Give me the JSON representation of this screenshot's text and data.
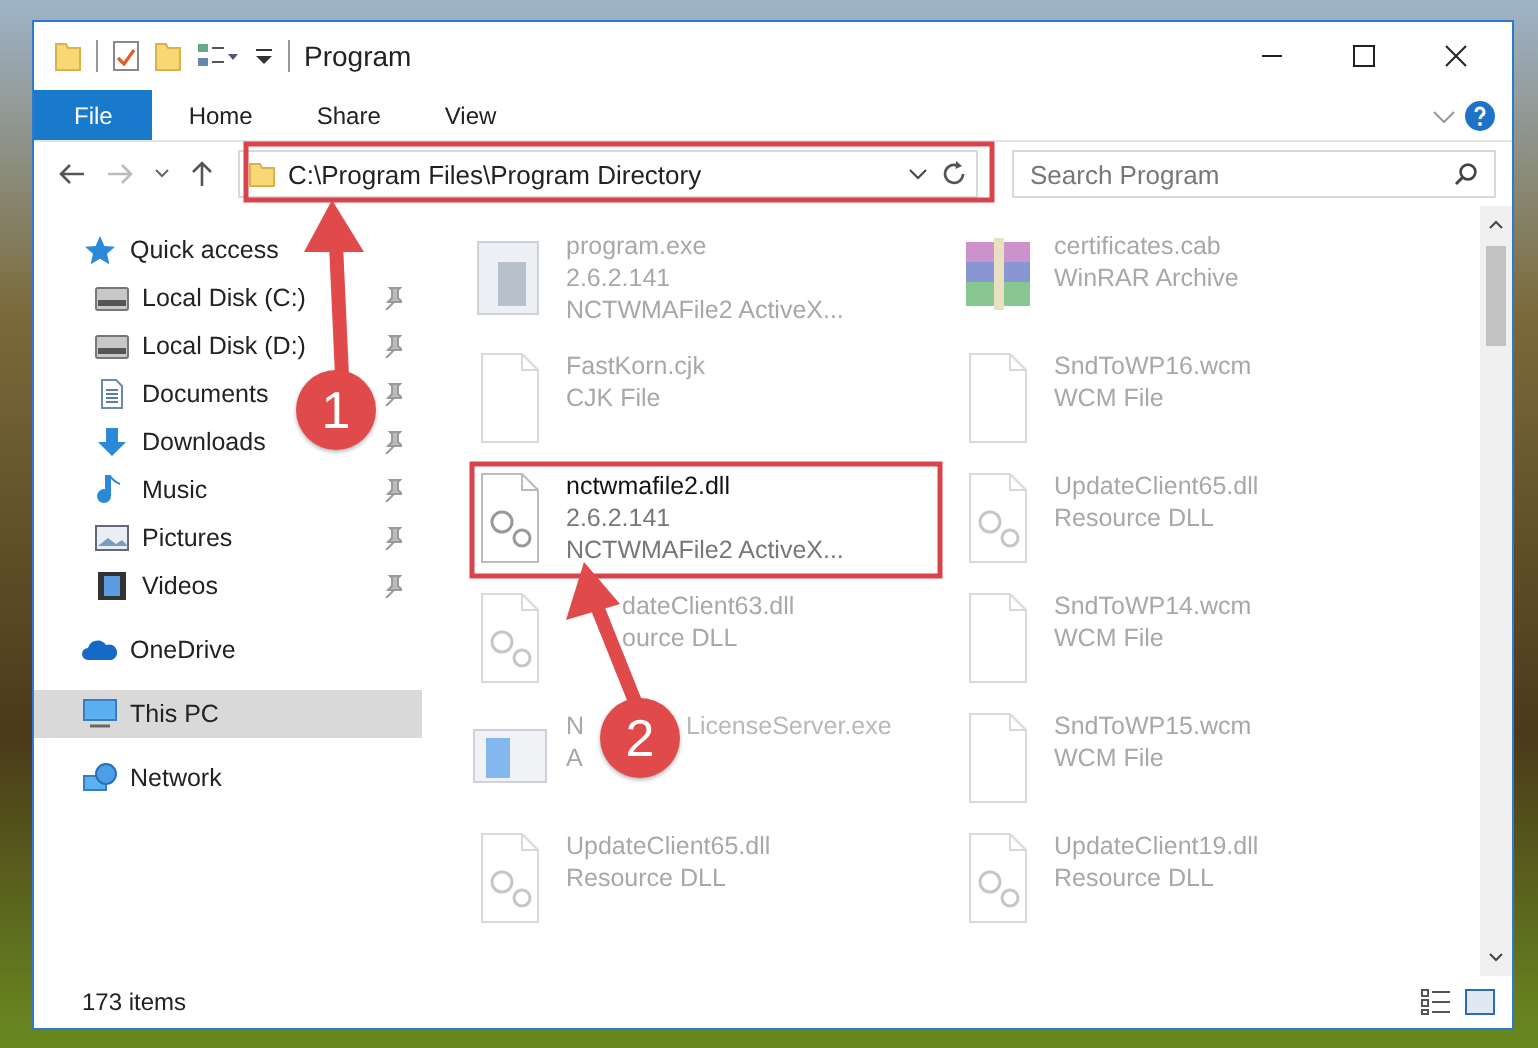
{
  "window": {
    "title": "Program"
  },
  "ribbon": {
    "tabs": [
      {
        "label": "File",
        "selected": true
      },
      {
        "label": "Home",
        "selected": false
      },
      {
        "label": "Share",
        "selected": false
      },
      {
        "label": "View",
        "selected": false
      }
    ]
  },
  "address": {
    "path": "C:\\Program Files\\Program Directory"
  },
  "search": {
    "placeholder": "Search Program"
  },
  "sidebar": {
    "items": [
      {
        "label": "Quick access",
        "kind": "star",
        "selected": false,
        "children": [
          {
            "label": "Local Disk (C:)",
            "kind": "drive",
            "pinned": true
          },
          {
            "label": "Local Disk (D:)",
            "kind": "drive",
            "pinned": true
          },
          {
            "label": "Documents",
            "kind": "doc",
            "pinned": true
          },
          {
            "label": "Downloads",
            "kind": "download",
            "pinned": true
          },
          {
            "label": "Music",
            "kind": "music",
            "pinned": true
          },
          {
            "label": "Pictures",
            "kind": "picture",
            "pinned": true
          },
          {
            "label": "Videos",
            "kind": "video",
            "pinned": true
          }
        ]
      },
      {
        "label": "OneDrive",
        "kind": "cloud",
        "selected": false
      },
      {
        "label": "This PC",
        "kind": "pc",
        "selected": true
      },
      {
        "label": "Network",
        "kind": "network",
        "selected": false
      }
    ]
  },
  "files": [
    {
      "name": "program.exe",
      "lines": [
        "2.6.2.141",
        "NCTWMAFile2 ActiveX..."
      ],
      "kind": "exe",
      "dimmed": true
    },
    {
      "name": "certificates.cab",
      "lines": [
        "WinRAR Archive"
      ],
      "kind": "archive",
      "dimmed": true
    },
    {
      "name": "FastKorn.cjk",
      "lines": [
        "CJK File"
      ],
      "kind": "blank",
      "dimmed": true
    },
    {
      "name": "SndToWP16.wcm",
      "lines": [
        "WCM File"
      ],
      "kind": "blank",
      "dimmed": true
    },
    {
      "name": "nctwmafile2.dll",
      "lines": [
        "2.6.2.141",
        "NCTWMAFile2 ActiveX..."
      ],
      "kind": "dll",
      "dimmed": false
    },
    {
      "name": "UpdateClient65.dll",
      "lines": [
        "Resource DLL"
      ],
      "kind": "dll",
      "dimmed": true
    },
    {
      "name": "dateClient63.dll",
      "lines": [
        "ource DLL"
      ],
      "kind": "dll",
      "dimmed": true,
      "indent": true
    },
    {
      "name": "SndToWP14.wcm",
      "lines": [
        "WCM File"
      ],
      "kind": "blank",
      "dimmed": true
    },
    {
      "name": "N",
      "lines": [
        "A"
      ],
      "kind": "app",
      "dimmed": true,
      "tail": "LicenseServer.exe"
    },
    {
      "name": "SndToWP15.wcm",
      "lines": [
        "WCM File"
      ],
      "kind": "blank",
      "dimmed": true
    },
    {
      "name": "UpdateClient65.dll",
      "lines": [
        "Resource DLL"
      ],
      "kind": "dll",
      "dimmed": true
    },
    {
      "name": "UpdateClient19.dll",
      "lines": [
        "Resource DLL"
      ],
      "kind": "dll",
      "dimmed": true
    }
  ],
  "annotations": [
    {
      "number": "1"
    },
    {
      "number": "2"
    }
  ],
  "status_bar": {
    "count": "173 items"
  }
}
